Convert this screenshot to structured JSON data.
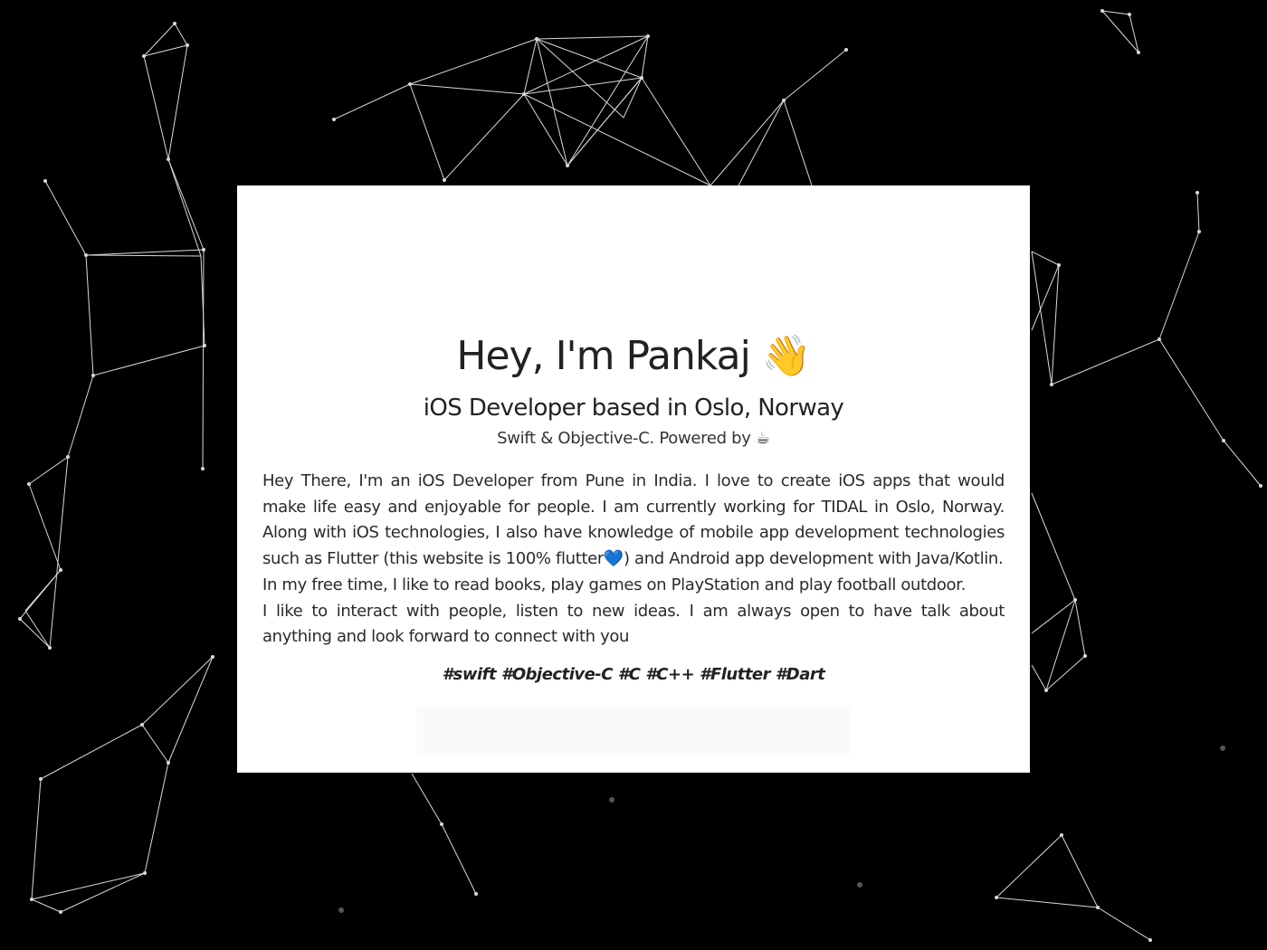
{
  "hero": {
    "title": "Hey, I'm Pankaj 👋",
    "subtitle": "iOS Developer based in Oslo, Norway",
    "tagline": "Swift & Objective-C. Powered by ☕"
  },
  "bio": {
    "paragraph_1": "Hey There, I'm an iOS Developer from Pune in India. I love to create iOS apps that would make life easy and enjoyable for people. I am currently working for TIDAL in Oslo, Norway. Along with iOS technologies, I also have knowledge of mobile app development technologies such as Flutter (this website is 100% flutter💙) and Android app development with Java/Kotlin.",
    "paragraph_2": "In my free time, I like to read books, play games on PlayStation and play football outdoor.",
    "paragraph_3": "I like to interact with people, listen to new ideas. I am always open to have talk about anything and look forward to connect with you"
  },
  "tags": "#swift #Objective-C #C #C++ #Flutter #Dart",
  "colors": {
    "background": "#000000",
    "card": "#ffffff",
    "network_lines": "#d9d9d9",
    "text": "#222222"
  }
}
